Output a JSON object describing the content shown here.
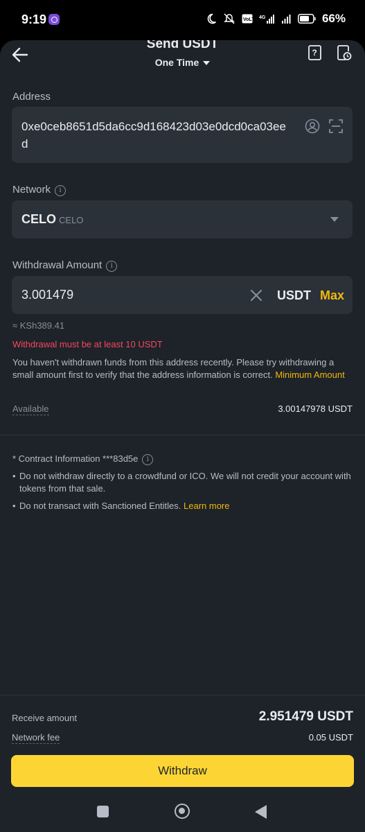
{
  "status_bar": {
    "time": "9:19",
    "battery_percent": "66%",
    "icons": [
      "moon-icon",
      "mute-icon",
      "volte-icon",
      "4g-signal-icon",
      "signal-icon",
      "battery-icon"
    ]
  },
  "header": {
    "title": "Send USDT",
    "mode": "One Time",
    "icons": [
      "back-arrow-icon",
      "help-document-icon",
      "history-icon"
    ]
  },
  "address": {
    "label": "Address",
    "value": "0xe0ceb8651d5da6cc9d168423d03e0dcd0ca03eed"
  },
  "network": {
    "label": "Network",
    "selected": "CELO",
    "selected_sub": "CELO"
  },
  "amount": {
    "label": "Withdrawal Amount",
    "value": "3.001479",
    "unit": "USDT",
    "max_label": "Max",
    "approx": "≈ KSh389.41",
    "error": "Withdrawal must be at least 10 USDT",
    "note": "You haven't withdrawn funds from this address recently. Please try withdrawing a small amount first to verify that the address information is correct. ",
    "note_link": "Minimum Amount",
    "available_label": "Available",
    "available_value": "3.00147978 USDT"
  },
  "contract": {
    "label": "* Contract Information ***83d5e",
    "bullet1": "Do not withdraw directly to a crowdfund or ICO. We will not credit your account with tokens from that sale.",
    "bullet2": "Do not transact with Sanctioned Entitles. ",
    "bullet2_link": "Learn more"
  },
  "footer": {
    "receive_label": "Receive amount",
    "receive_value": "2.951479 USDT",
    "fee_label": "Network fee",
    "fee_value": "0.05 USDT",
    "button": "Withdraw"
  },
  "colors": {
    "accent": "#fcd535",
    "link": "#f0b90b",
    "error": "#f6465d",
    "background": "#1e2329",
    "field": "#2b3139"
  }
}
